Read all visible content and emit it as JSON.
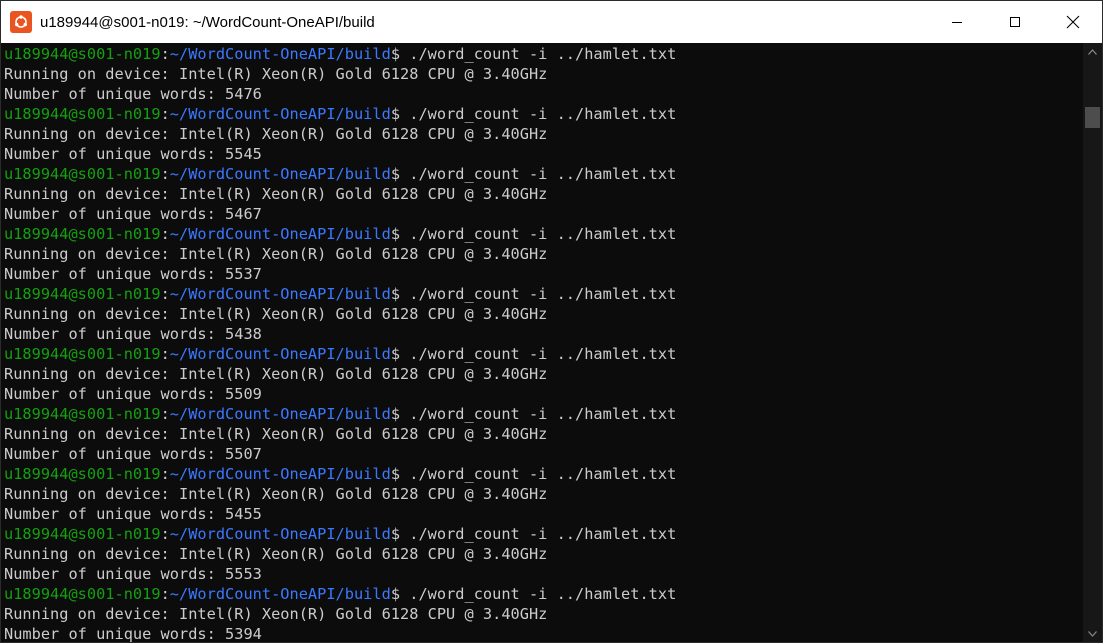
{
  "window": {
    "title": "u189944@s001-n019: ~/WordCount-OneAPI/build",
    "app_icon": "ubuntu-icon",
    "controls": [
      "minimize-icon",
      "maximize-icon",
      "close-icon"
    ]
  },
  "colors": {
    "background": "#0c0c0c",
    "text": "#cccccc",
    "prompt_user": "#13a10e",
    "prompt_path": "#3b78ff",
    "icon_brand": "#e95420"
  },
  "terminal": {
    "prompt_user": "u189944@s001-n019",
    "prompt_sep": ":",
    "prompt_path": "~/WordCount-OneAPI/build",
    "prompt_end": "$ ",
    "command": "./word_count -i ../hamlet.txt",
    "runs": [
      {
        "device": "Running on device: Intel(R) Xeon(R) Gold 6128 CPU @ 3.40GHz",
        "result": "Number of unique words: 5476"
      },
      {
        "device": "Running on device: Intel(R) Xeon(R) Gold 6128 CPU @ 3.40GHz",
        "result": "Number of unique words: 5545"
      },
      {
        "device": "Running on device: Intel(R) Xeon(R) Gold 6128 CPU @ 3.40GHz",
        "result": "Number of unique words: 5467"
      },
      {
        "device": "Running on device: Intel(R) Xeon(R) Gold 6128 CPU @ 3.40GHz",
        "result": "Number of unique words: 5537"
      },
      {
        "device": "Running on device: Intel(R) Xeon(R) Gold 6128 CPU @ 3.40GHz",
        "result": "Number of unique words: 5438"
      },
      {
        "device": "Running on device: Intel(R) Xeon(R) Gold 6128 CPU @ 3.40GHz",
        "result": "Number of unique words: 5509"
      },
      {
        "device": "Running on device: Intel(R) Xeon(R) Gold 6128 CPU @ 3.40GHz",
        "result": "Number of unique words: 5507"
      },
      {
        "device": "Running on device: Intel(R) Xeon(R) Gold 6128 CPU @ 3.40GHz",
        "result": "Number of unique words: 5455"
      },
      {
        "device": "Running on device: Intel(R) Xeon(R) Gold 6128 CPU @ 3.40GHz",
        "result": "Number of unique words: 5553"
      },
      {
        "device": "Running on device: Intel(R) Xeon(R) Gold 6128 CPU @ 3.40GHz",
        "result": "Number of unique words: 5394"
      }
    ]
  },
  "scrollbar": {
    "icons": [
      "scroll-up-arrow-icon",
      "scroll-down-arrow-icon"
    ]
  }
}
